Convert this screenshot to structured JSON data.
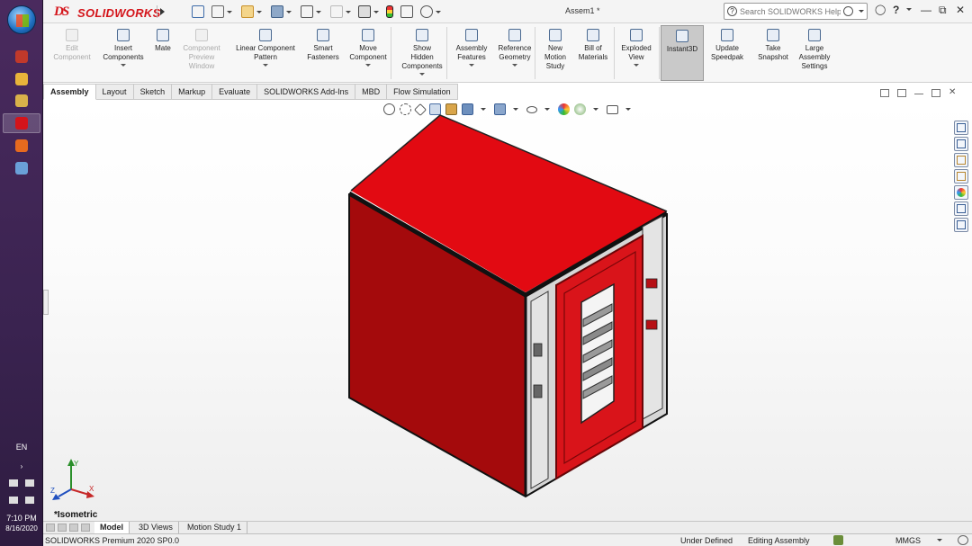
{
  "taskbar": {
    "language": "EN",
    "time": "7:10 PM",
    "date": "8/16/2020",
    "apps": [
      {
        "name": "powerpoint-icon",
        "color": "#c0392b"
      },
      {
        "name": "chrome-icon",
        "color": "#e8b43a"
      },
      {
        "name": "file-explorer-icon",
        "color": "#d9b24a"
      },
      {
        "name": "solidworks-icon",
        "color": "#d4141a"
      },
      {
        "name": "firefox-icon",
        "color": "#e66a1f"
      },
      {
        "name": "document-icon",
        "color": "#6aa0d8"
      }
    ]
  },
  "titlebar": {
    "brand": "SOLIDWORKS",
    "document": "Assem1 *",
    "search_placeholder": "Search SOLIDWORKS Help"
  },
  "ribbon": {
    "commands": [
      {
        "label": "Edit\nComponent",
        "enabled": false
      },
      {
        "label": "Insert\nComponents",
        "enabled": true
      },
      {
        "label": "Mate",
        "enabled": true
      },
      {
        "label": "Component\nPreview\nWindow",
        "enabled": false
      },
      {
        "label": "Linear Component\nPattern",
        "enabled": true
      },
      {
        "label": "Smart\nFasteners",
        "enabled": true
      },
      {
        "label": "Move\nComponent",
        "enabled": true
      },
      {
        "label": "Show\nHidden\nComponents",
        "enabled": true
      },
      {
        "label": "Assembly\nFeatures",
        "enabled": true
      },
      {
        "label": "Reference\nGeometry",
        "enabled": true
      },
      {
        "label": "New\nMotion\nStudy",
        "enabled": true
      },
      {
        "label": "Bill of\nMaterials",
        "enabled": true
      },
      {
        "label": "Exploded\nView",
        "enabled": true
      },
      {
        "label": "Instant3D",
        "enabled": true,
        "pressed": true
      },
      {
        "label": "Update\nSpeedpak",
        "enabled": true
      },
      {
        "label": "Take\nSnapshot",
        "enabled": true
      },
      {
        "label": "Large\nAssembly\nSettings",
        "enabled": true
      }
    ]
  },
  "tabs": [
    "Assembly",
    "Layout",
    "Sketch",
    "Markup",
    "Evaluate",
    "SOLIDWORKS Add-Ins",
    "MBD",
    "Flow Simulation"
  ],
  "active_tab": "Assembly",
  "viewport": {
    "view_name": "*Isometric",
    "model_colors": {
      "top": "#e20a12",
      "front": "#a40a0c",
      "side": "#d6d6d6",
      "door": "#d9141a"
    }
  },
  "bottom_tabs": [
    "Model",
    "3D Views",
    "Motion Study 1"
  ],
  "active_bottom_tab": "Model",
  "status": {
    "product": "SOLIDWORKS Premium 2020 SP0.0",
    "definition": "Under Defined",
    "mode": "Editing Assembly",
    "units": "MMGS"
  }
}
